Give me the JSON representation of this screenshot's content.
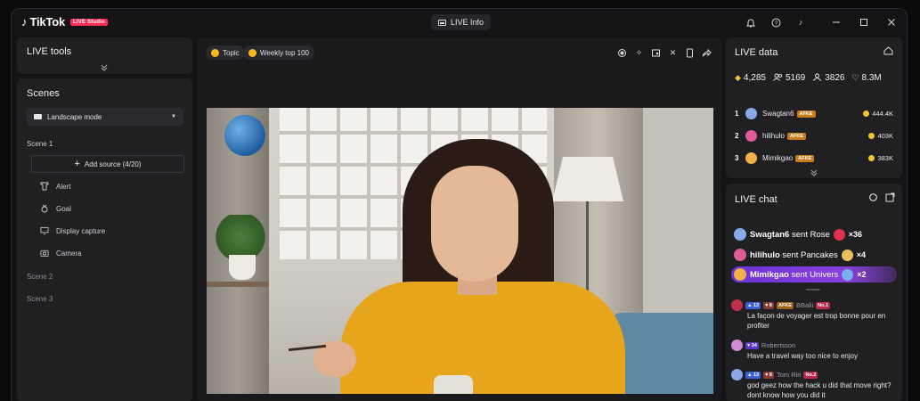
{
  "app": {
    "brand": "TikTok",
    "brand_badge": "LIVE Studio"
  },
  "titlebar": {
    "live_info_label": "LIVE Info"
  },
  "live_tools": {
    "title": "LIVE tools"
  },
  "scenes": {
    "title": "Scenes",
    "mode_select": "Landscape mode",
    "scene1": "Scene 1",
    "add_source": "Add source (4/20)",
    "sources": [
      {
        "label": "Alert",
        "icon": "alert-icon"
      },
      {
        "label": "Goal",
        "icon": "goal-icon"
      },
      {
        "label": "Display capture",
        "icon": "display-icon"
      },
      {
        "label": "Camera",
        "icon": "camera-icon"
      }
    ],
    "scene2": "Scene 2",
    "scene3": "Scene 3"
  },
  "center": {
    "topic_chip": "Topic",
    "weekly_chip": "Weekly top 100"
  },
  "live_data": {
    "title": "LIVE data",
    "stats": {
      "coins": "4,285",
      "viewers": "5169",
      "shares": "3826",
      "likes": "8.3M"
    },
    "ranking": [
      {
        "rank": "1",
        "name": "Swagtan6",
        "badge": "AFKE",
        "value": "444.4K",
        "avatar_color": "#8aa8e8"
      },
      {
        "rank": "2",
        "name": "hilihulo",
        "badge": "AFKE",
        "value": "403K",
        "avatar_color": "#e05a9a"
      },
      {
        "rank": "3",
        "name": "Mimikgao",
        "badge": "AFKE",
        "value": "383K",
        "avatar_color": "#f0b04a"
      }
    ]
  },
  "live_chat": {
    "title": "LIVE chat",
    "gifts": [
      {
        "user": "Swagtan6",
        "verb": "sent",
        "gift": "Rose",
        "count": "×36",
        "avatar_color": "#8aa8e8",
        "gift_color": "#e0304a"
      },
      {
        "user": "hilihulo",
        "verb": "sent",
        "gift": "Pancakes",
        "count": "×4",
        "avatar_color": "#e05a9a",
        "gift_color": "#e8c060"
      },
      {
        "user": "Mimikgao",
        "verb": "sent",
        "gift": "Univers",
        "count": "×2",
        "avatar_color": "#f0b04a",
        "gift_color": "#7ab0f0"
      }
    ],
    "messages": [
      {
        "level": "13",
        "fan": "8",
        "afk": "AFKE",
        "user": "BBalii",
        "rank": "No.1",
        "text": "La façon de voyager est trop bonne pour en profiter",
        "avatar_color": "#c0304a"
      },
      {
        "level": "34",
        "user": "Robertsson",
        "text": "Have a travel way too nice to enjoy",
        "avatar_color": "#d08ad8"
      },
      {
        "level": "13",
        "fan": "8",
        "user": "Tom Riri",
        "rank": "No.2",
        "text": "god geez how the hack u did that move right? dont know how you did it",
        "avatar_color": "#8aa8e8"
      }
    ]
  }
}
